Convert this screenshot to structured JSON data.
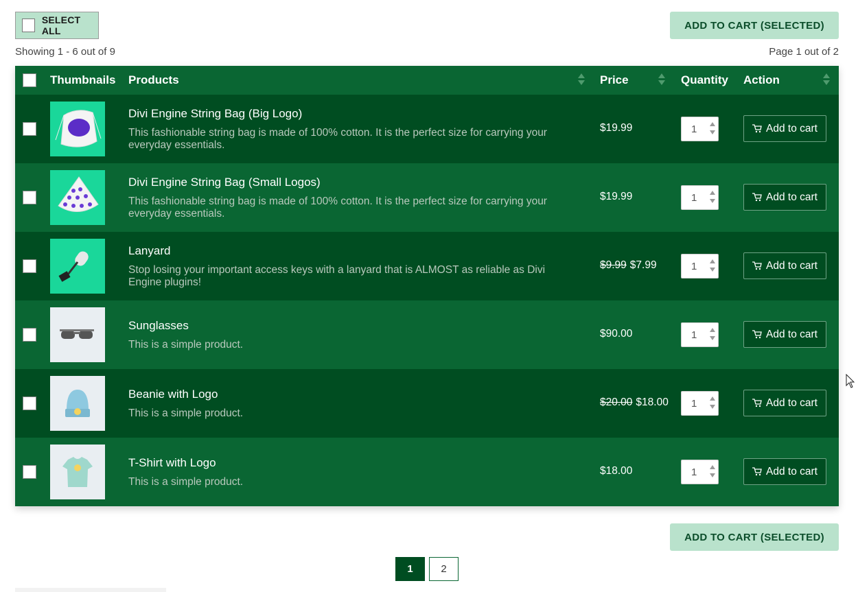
{
  "toolbar": {
    "select_all_label": "SELECT ALL",
    "add_selected_label": "ADD TO CART (SELECTED)",
    "showing_text": "Showing 1 - 6 out of 9",
    "page_text": "Page 1 out of 2"
  },
  "table": {
    "headers": {
      "thumbnails": "Thumbnails",
      "products": "Products",
      "price": "Price",
      "quantity": "Quantity",
      "action": "Action"
    },
    "rows": [
      {
        "name": "Divi Engine String Bag (Big Logo)",
        "desc": "This fashionable string bag is made of 100% cotton. It is the perfect size for carrying your everyday essentials.",
        "old_price": "",
        "price": "$19.99",
        "qty": "1",
        "action": "Add to cart",
        "thumb": "string-bag-big-logo-thumbnail"
      },
      {
        "name": "Divi Engine String Bag (Small Logos)",
        "desc": "This fashionable string bag is made of 100% cotton. It is the perfect size for carrying your everyday essentials.",
        "old_price": "",
        "price": "$19.99",
        "qty": "1",
        "action": "Add to cart",
        "thumb": "string-bag-small-logos-thumbnail"
      },
      {
        "name": "Lanyard",
        "desc": "Stop losing your important access keys with a lanyard that is ALMOST as reliable as Divi Engine plugins!",
        "old_price": "$9.99",
        "price": "$7.99",
        "qty": "1",
        "action": "Add to cart",
        "thumb": "lanyard-thumbnail"
      },
      {
        "name": "Sunglasses",
        "desc": "This is a simple product.",
        "old_price": "",
        "price": "$90.00",
        "qty": "1",
        "action": "Add to cart",
        "thumb": "sunglasses-thumbnail"
      },
      {
        "name": "Beanie with Logo",
        "desc": "This is a simple product.",
        "old_price": "$20.00",
        "price": "$18.00",
        "qty": "1",
        "action": "Add to cart",
        "thumb": "beanie-thumbnail"
      },
      {
        "name": "T-Shirt with Logo",
        "desc": "This is a simple product.",
        "old_price": "",
        "price": "$18.00",
        "qty": "1",
        "action": "Add to cart",
        "thumb": "tshirt-thumbnail"
      }
    ]
  },
  "pagination": {
    "pages": [
      "1",
      "2"
    ],
    "current": "1"
  },
  "colors": {
    "header_green": "#0a6633",
    "row_dark": "#004d21",
    "row_light": "#0a6633",
    "button_mint": "#b9e2cc"
  }
}
